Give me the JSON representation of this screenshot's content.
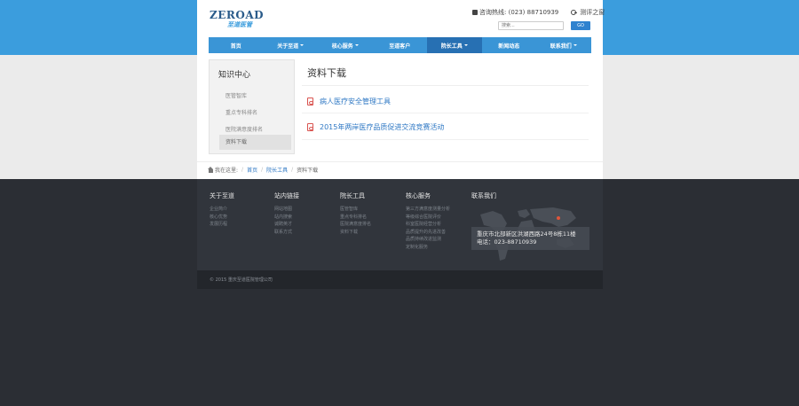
{
  "colors": {
    "brand_blue": "#3b9ddd",
    "nav_blue": "#3a95d6",
    "nav_active": "#2770b3",
    "link_blue": "#2f78c4",
    "pdf_red": "#d9534f",
    "footer_dark": "#31353c"
  },
  "header": {
    "logo_main": "ZEROAD",
    "logo_sub": "至道医管",
    "hotline": "咨询热线: (023) 88710939",
    "tools_link": "测评之窗",
    "search_placeholder": "搜索...",
    "search_button": "GO"
  },
  "nav": {
    "items": [
      {
        "label": "首页",
        "dropdown": false,
        "active": false
      },
      {
        "label": "关于至道",
        "dropdown": true,
        "active": false
      },
      {
        "label": "核心服务",
        "dropdown": true,
        "active": false
      },
      {
        "label": "至道客户",
        "dropdown": false,
        "active": false
      },
      {
        "label": "院长工具",
        "dropdown": true,
        "active": true
      },
      {
        "label": "新闻动态",
        "dropdown": false,
        "active": false
      },
      {
        "label": "联系我们",
        "dropdown": true,
        "active": false
      }
    ]
  },
  "sidebar": {
    "title": "知识中心",
    "items": [
      {
        "label": "医管智库",
        "active": false
      },
      {
        "label": "重点专科排名",
        "active": false
      },
      {
        "label": "医院满意度排名",
        "active": false
      },
      {
        "label": "资料下载",
        "active": true
      }
    ]
  },
  "content": {
    "title": "资料下载",
    "documents": [
      {
        "label": "病人医疗安全管理工具",
        "icon": "pdf-icon"
      },
      {
        "label": "2015年两岸医疗品质促进交流竞赛活动",
        "icon": "pdf-icon"
      }
    ]
  },
  "breadcrumb": {
    "prefix": "我在这里:",
    "items": [
      "首页",
      "院长工具",
      "资料下载"
    ]
  },
  "footer": {
    "columns": [
      {
        "title": "关于至道",
        "links": [
          "企业简介",
          "核心优势",
          "发展历程"
        ]
      },
      {
        "title": "站内链接",
        "links": [
          "网站地图",
          "站内搜索",
          "诚聘英才",
          "联系方式"
        ]
      },
      {
        "title": "院长工具",
        "links": [
          "医管智库",
          "重点专科排名",
          "医院满意度排名",
          "资料下载"
        ]
      },
      {
        "title": "核心服务",
        "links": [
          "第三方满意度测量分析",
          "等级综合医院评价",
          "科室医院经营分析",
          "品质提升的先进改善",
          "品质持续改进监测",
          "定制化服务"
        ]
      }
    ],
    "contact_title": "联系我们",
    "address": "重庆市北部新区洪湖西路24号8栋11楼",
    "phone": "电话：023-88710939",
    "copyright": "© 2015 重庆至道医院管理公司"
  }
}
